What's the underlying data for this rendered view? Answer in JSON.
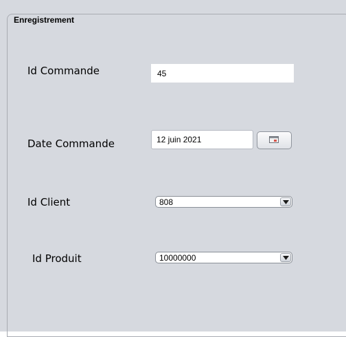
{
  "form": {
    "legend": "Enregistrement",
    "id_commande": {
      "label": "Id Commande",
      "value": "45"
    },
    "date_commande": {
      "label": "Date Commande",
      "value": "12 juin 2021"
    },
    "id_client": {
      "label": "Id Client",
      "value": "808"
    },
    "id_produit": {
      "label": "Id Produit",
      "value": "10000000"
    }
  },
  "icons": {
    "calendar": "calendar-icon",
    "dropdown": "chevron-down-icon"
  }
}
